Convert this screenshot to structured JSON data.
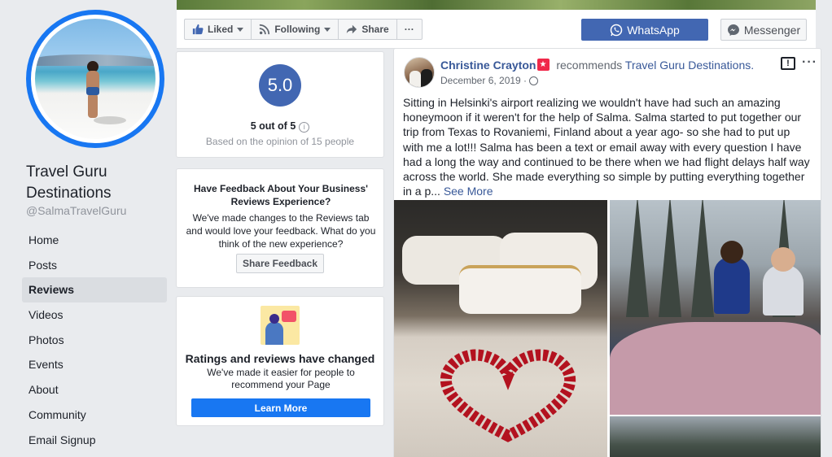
{
  "page": {
    "name": "Travel Guru Destinations",
    "handle": "@SalmaTravelGuru"
  },
  "sidebar": {
    "items": [
      {
        "label": "Home",
        "active": false
      },
      {
        "label": "Posts",
        "active": false
      },
      {
        "label": "Reviews",
        "active": true
      },
      {
        "label": "Videos",
        "active": false
      },
      {
        "label": "Photos",
        "active": false
      },
      {
        "label": "Events",
        "active": false
      },
      {
        "label": "About",
        "active": false
      },
      {
        "label": "Community",
        "active": false
      },
      {
        "label": "Email Signup",
        "active": false
      }
    ]
  },
  "action_bar": {
    "liked_label": "Liked",
    "following_label": "Following",
    "share_label": "Share",
    "more_label": "···",
    "whatsapp_label": "WhatsApp",
    "messenger_label": "Messenger"
  },
  "rating": {
    "score": "5.0",
    "out_of": "5 out of 5",
    "basis": "Based on the opinion of 15 people"
  },
  "feedback": {
    "title": "Have Feedback About Your Business' Reviews Experience?",
    "body": "We've made changes to the Reviews tab and would love your feedback. What do you think of the new experience?",
    "button_label": "Share Feedback"
  },
  "changes": {
    "title": "Ratings and reviews have changed",
    "body": "We've made it easier for people to recommend your Page",
    "button_label": "Learn More"
  },
  "post": {
    "author": "Christine Crayton",
    "verb": "recommends",
    "page_link": "Travel Guru Destinations.",
    "date": "December 6, 2019 ·",
    "text": "Sitting in Helsinki's airport realizing we wouldn't have had such an amazing honeymoon if it weren't for the help of Salma. Salma started to put together our trip from Texas to Rovaniemi, Finland about a year ago- so she had to put up with me a lot!!! Salma has been a text or email away with every question I have had a long the way and continued to be there when we had flight delays half way across the world. She made everything so simple by putting everything together in a p...",
    "see_more": "See More",
    "more_menu": "···"
  },
  "colors": {
    "brand_blue": "#4267b2",
    "link_blue": "#385898",
    "button_blue": "#1877f2",
    "page_bg": "#e9ebee"
  }
}
